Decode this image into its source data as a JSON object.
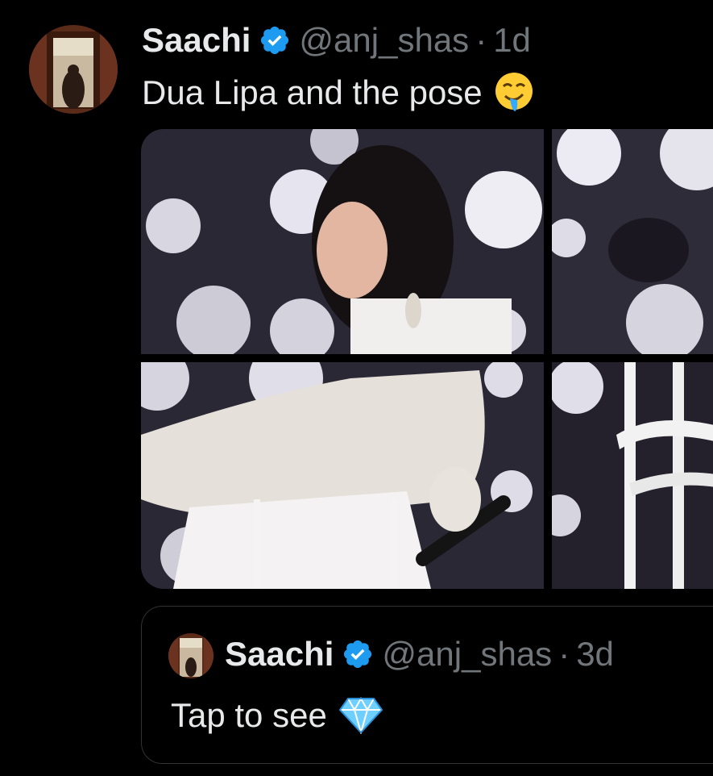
{
  "tweet": {
    "author_name": "Saachi",
    "handle": "@anj_shas",
    "separator": "·",
    "time": "1d",
    "text": "Dua Lipa and the pose",
    "text_emoji": "drooling-face",
    "media_count_visible": 4
  },
  "quoted_tweet": {
    "author_name": "Saachi",
    "handle": "@anj_shas",
    "separator": "·",
    "time": "3d",
    "text": "Tap to see",
    "text_emoji": "gem"
  },
  "colors": {
    "background": "#000000",
    "text_primary": "#e7e9ea",
    "text_secondary": "#71767b",
    "verified_blue": "#1d9bf0",
    "border": "#2f3336"
  }
}
